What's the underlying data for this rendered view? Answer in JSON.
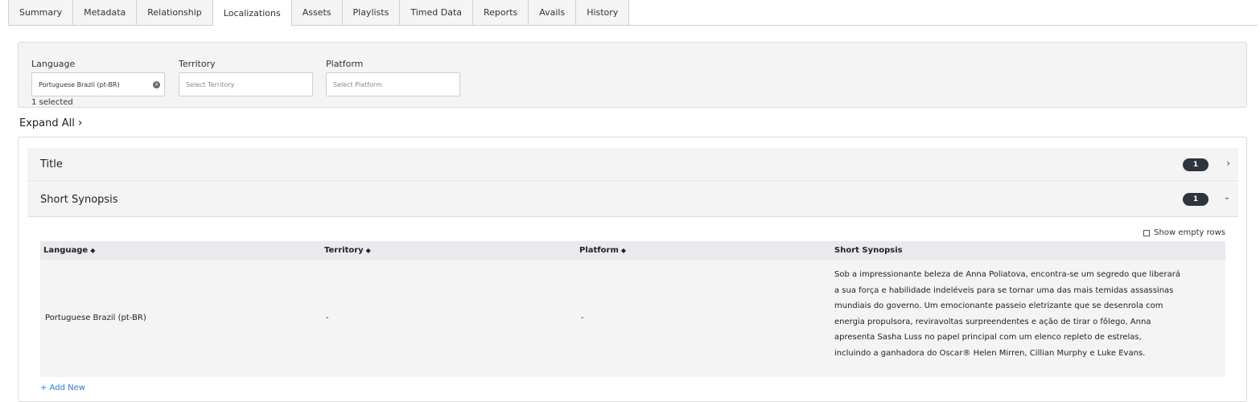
{
  "tabs": [
    {
      "label": "Summary"
    },
    {
      "label": "Metadata"
    },
    {
      "label": "Relationship"
    },
    {
      "label": "Localizations",
      "active": true
    },
    {
      "label": "Assets"
    },
    {
      "label": "Playlists"
    },
    {
      "label": "Timed Data"
    },
    {
      "label": "Reports"
    },
    {
      "label": "Avails"
    },
    {
      "label": "History"
    }
  ],
  "filters": {
    "language": {
      "label": "Language",
      "value": "Portuguese Brazil (pt-BR)",
      "selected_count": "1 selected"
    },
    "territory": {
      "label": "Territory",
      "placeholder": "Select Territory"
    },
    "platform": {
      "label": "Platform",
      "placeholder": "Select Platform"
    }
  },
  "expand_all": "Expand All",
  "sections": [
    {
      "label": "Title",
      "count": "1",
      "expanded": false
    },
    {
      "label": "Short Synopsis",
      "count": "1",
      "expanded": true
    }
  ],
  "table": {
    "show_empty_rows": "Show empty rows",
    "columns": [
      "Language",
      "Territory",
      "Platform",
      "Short Synopsis"
    ],
    "rows": [
      {
        "language": "Portuguese Brazil (pt-BR)",
        "territory": "-",
        "platform": "-",
        "synopsis": "Sob a impressionante beleza de Anna Poliatova, encontra-se um segredo que liberará a sua força e habilidade indeléveis para se tornar uma das mais temidas assassinas mundiais do governo. Um emocionante passeio eletrizante que se desenrola com energia propulsora, reviravoltas surpreendentes e ação de tirar o fôlego, Anna apresenta Sasha Luss no papel principal com um elenco repleto de estrelas, incluindo a ganhadora do Oscar® Helen Mirren, Cillian Murphy e Luke Evans."
      }
    ],
    "add_new": "+ Add New"
  },
  "colors": {
    "badge": "#2f353d",
    "link": "#2b7bd1",
    "panel_bg": "#f4f4f4"
  }
}
